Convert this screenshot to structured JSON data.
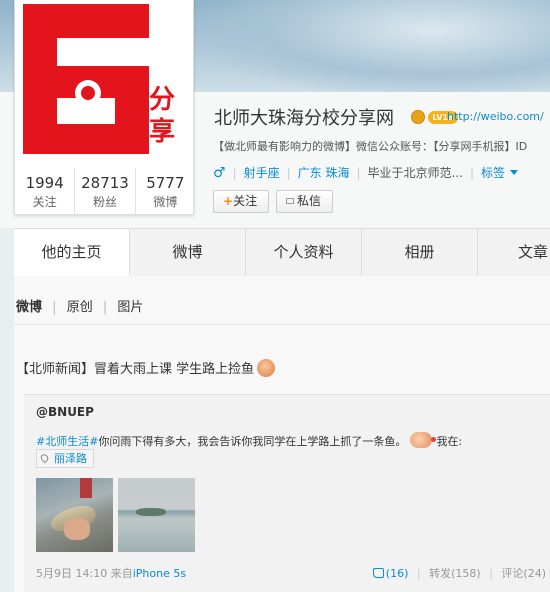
{
  "profile": {
    "avatar_text": "分享",
    "name": "北师大珠海分校分享网",
    "vip_badge": "LV18",
    "url": "http://weibo.com/",
    "description": "【做北师最有影响力的微博】微信公众账号：【分享网手机报】ID",
    "gender_icon": "♂",
    "meta": [
      "射手座",
      "广东 珠海",
      "毕业于北京师范..."
    ],
    "tags_label": "标签",
    "stats": [
      {
        "value": "1994",
        "label": "关注"
      },
      {
        "value": "28713",
        "label": "粉丝"
      },
      {
        "value": "5777",
        "label": "微博"
      }
    ],
    "follow_label": "关注",
    "message_label": "私信"
  },
  "tabs": [
    "他的主页",
    "微博",
    "个人资料",
    "相册",
    "文章"
  ],
  "subnav": [
    "微博",
    "原创",
    "图片"
  ],
  "post": {
    "text": "【北师新闻】冒着大雨上课 学生路上捡鱼",
    "repost": {
      "author": "@BNUEP",
      "topic": "#北师生活#",
      "text_before": "你问雨下得有多大，我会告诉你我同学在上学路上抓了一条鱼。",
      "text_after": "我在:",
      "location": "丽泽路"
    },
    "footer": {
      "time": "5月9日 14:10",
      "source_prefix": "来自",
      "source": "iPhone 5s",
      "likes": "(16)",
      "reposts": "转发(158)",
      "comments": "评论(24)"
    }
  },
  "colors": {
    "brand_red": "#e3141c",
    "link_blue": "#0a8cd2",
    "follow_plus": "#f68b1f"
  }
}
